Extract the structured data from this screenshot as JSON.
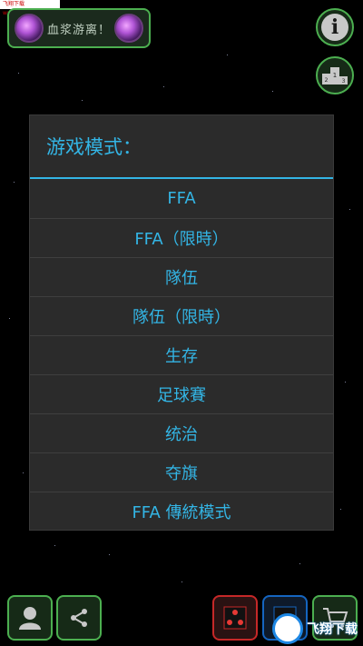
{
  "watermark_top": "飞翔下载 www.FXXZ.com",
  "header": {
    "title": "血浆游离！"
  },
  "dialog": {
    "title": "游戏模式：",
    "items": [
      "FFA",
      "FFA（限時）",
      "隊伍",
      "隊伍（限時）",
      "生存",
      "足球賽",
      "统治",
      "夺旗",
      "FFA  傳統模式"
    ]
  },
  "watermark_bottom": "飞翔下载",
  "colors": {
    "accent": "#33b5e5",
    "green": "#4caf50",
    "dialog_bg": "#2b2b2b"
  },
  "icons": [
    "info-icon",
    "leaderboard-icon",
    "profile-icon",
    "share-icon",
    "red-mode-icon",
    "blue-mode-icon",
    "cart-icon"
  ]
}
